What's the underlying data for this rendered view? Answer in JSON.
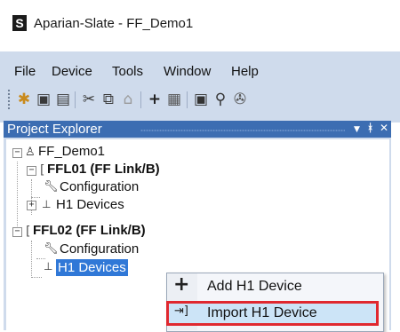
{
  "window": {
    "app_icon": "S",
    "title": "Aparian-Slate  - FF_Demo1"
  },
  "menu": [
    "File",
    "Device",
    "Tools",
    "Window",
    "Help"
  ],
  "toolbar": {
    "icons": [
      "new-file-icon",
      "open-file-icon",
      "save-icon",
      "cut-icon",
      "copy-icon",
      "paste-icon",
      "add-icon",
      "properties-icon",
      "module-icon",
      "network-icon",
      "settings-icon"
    ]
  },
  "panel": {
    "title": "Project Explorer",
    "buttons": [
      "dropdown-icon",
      "pin-icon",
      "close-icon"
    ]
  },
  "tree": {
    "root": {
      "label": "FF_Demo1"
    },
    "nodes": [
      {
        "label": "FFL01 (FF Link/B)",
        "bold": true
      },
      {
        "label": "Configuration"
      },
      {
        "label": "H1 Devices"
      },
      {
        "label": "FFL02 (FF Link/B)",
        "bold": true
      },
      {
        "label": "Configuration"
      },
      {
        "label": "H1 Devices",
        "selected": true
      }
    ]
  },
  "context_menu": {
    "items": [
      {
        "label": "Add H1 Device",
        "icon": "plus-icon"
      },
      {
        "label": "Import H1 Device",
        "icon": "import-icon",
        "highlighted": true
      }
    ]
  },
  "colors": {
    "chrome": "#cfdbec",
    "panel_header": "#3c6db2",
    "selection": "#3078d7",
    "highlight_border": "#e0282f"
  }
}
